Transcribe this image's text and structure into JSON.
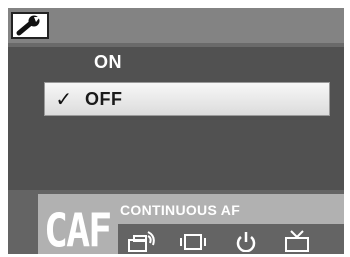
{
  "header": {
    "icon": "wrench-icon"
  },
  "menu": {
    "options": [
      {
        "label": "ON",
        "selected": false
      },
      {
        "label": "OFF",
        "selected": true
      }
    ],
    "check_glyph": "✓"
  },
  "status": {
    "mode_code": "CAF",
    "mode_name": "CONTINUOUS AF"
  },
  "bottom_tabs": [
    {
      "icon": "camera-mode-icon"
    },
    {
      "icon": "display-icon"
    },
    {
      "icon": "power-icon"
    },
    {
      "icon": "tv-icon"
    }
  ],
  "colors": {
    "screen_bg": "#515151",
    "header_bg": "#838383",
    "highlight_bg": "#e8e8e8",
    "label_box_bg": "#b1b1b1"
  }
}
